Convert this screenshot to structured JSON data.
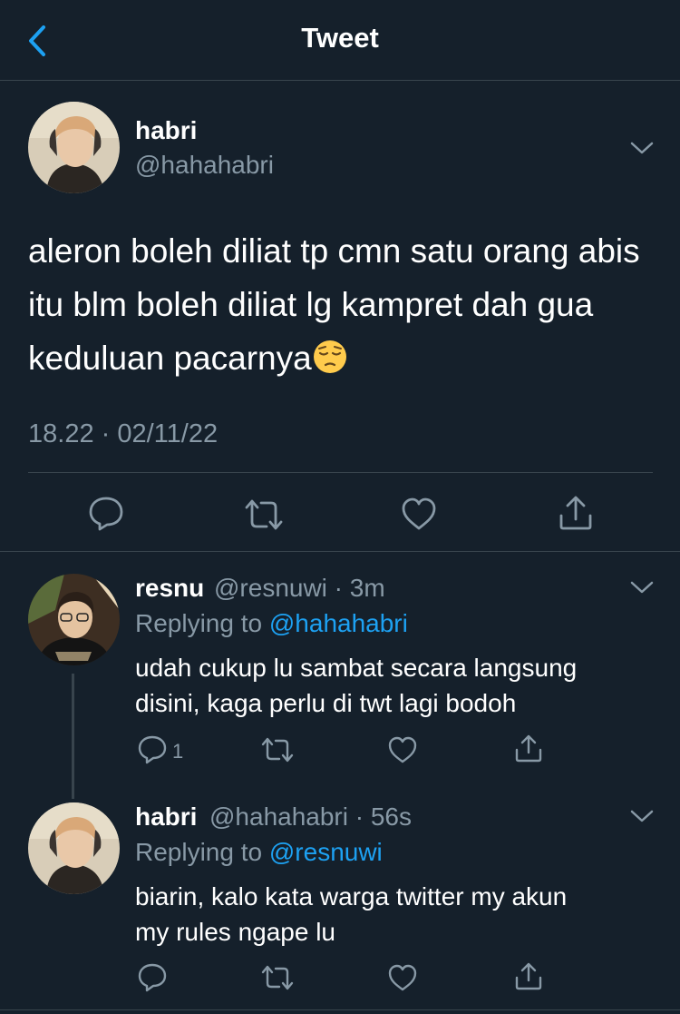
{
  "header": {
    "title": "Tweet"
  },
  "tweet": {
    "name": "habri",
    "handle": "@hahahabri",
    "text": "aleron boleh diliat tp cmn satu orang abis itu blm boleh diliat lg kampret dah gua keduluan pacarnya",
    "emoji": "pensive-face-emoji",
    "timestamp": "18.22 · 02/11/22"
  },
  "replies": [
    {
      "name": "resnu",
      "meta": "@resnuwi · 3m",
      "replying_prefix": "Replying to ",
      "replying_to": "@hahahabri",
      "text_line1": "udah cukup lu sambat secara langsung",
      "text_line2": "disini, kaga perlu di twt lagi bodoh",
      "reply_count": "1"
    },
    {
      "name": "habri",
      "meta": "@hahahabri · 56s",
      "replying_prefix": "Replying to ",
      "replying_to": "@resnuwi",
      "text_line1": "biarin, kalo kata warga twitter my akun",
      "text_line2": "my rules ngape lu"
    }
  ],
  "colors": {
    "background": "#15202b",
    "secondary_text": "#8899a6",
    "accent": "#1da1f2",
    "divider": "#38444d"
  }
}
